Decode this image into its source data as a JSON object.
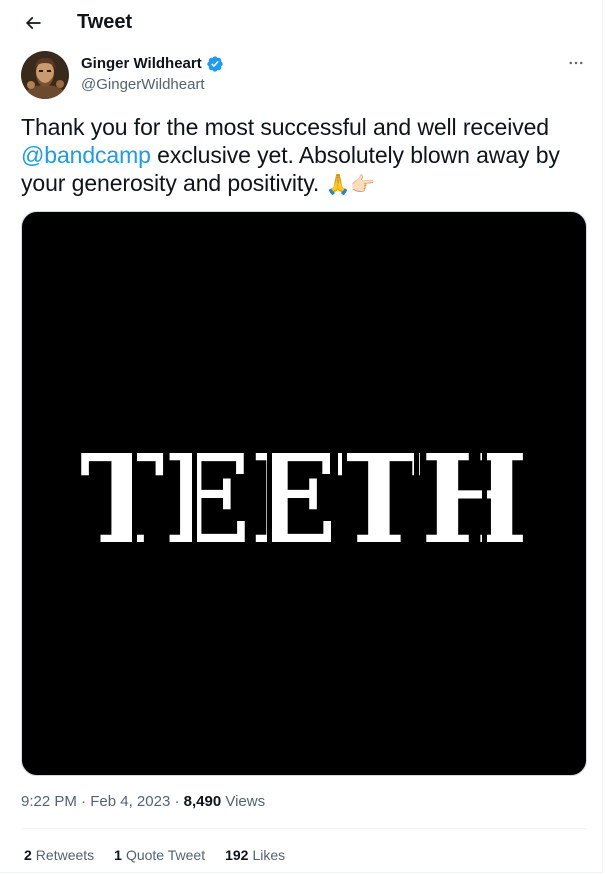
{
  "header": {
    "title": "Tweet",
    "back_icon": "arrow-left-icon"
  },
  "author": {
    "display_name": "Ginger Wildheart",
    "handle": "@GingerWildheart",
    "verified": true,
    "verified_color": "#1d9bf0",
    "more_icon": "more-horizontal-icon"
  },
  "tweet": {
    "text_before": "Thank you for the most successful and well received ",
    "mention": "@bandcamp",
    "text_after": " exclusive yet. Absolutely blown away by your generosity and positivity. ",
    "emojis": "🙏👉🏻",
    "media_text": "TEETH"
  },
  "meta": {
    "time": "9:22 PM",
    "separator": "·",
    "date": "Feb 4, 2023",
    "views_count": "8,490",
    "views_label": "Views"
  },
  "stats": {
    "retweets_count": "2",
    "retweets_label": "Retweets",
    "quotes_count": "1",
    "quotes_label": "Quote Tweet",
    "likes_count": "192",
    "likes_label": "Likes"
  },
  "colors": {
    "accent": "#1d9bf0",
    "text": "#0f1419",
    "secondary": "#536471",
    "border": "#eff3f4"
  }
}
